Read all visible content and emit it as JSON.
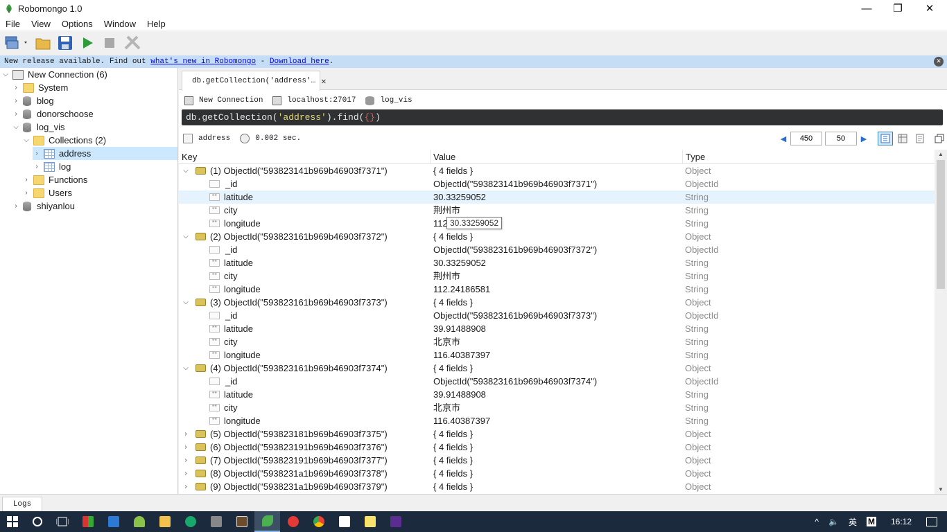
{
  "window": {
    "title": "Robomongo 1.0",
    "minimize": "—",
    "restore": "❐",
    "close": "✕"
  },
  "menu": [
    "File",
    "View",
    "Options",
    "Window",
    "Help"
  ],
  "notice": {
    "prefix": "New release available. Find out ",
    "link1": "what's new in Robomongo",
    "middle": " - ",
    "link2": "Download here",
    "suffix": "."
  },
  "tree": {
    "connection": "New Connection (6)",
    "system": "System",
    "db1": "blog",
    "db2": "donorschoose",
    "db3": "log_vis",
    "collections": "Collections (2)",
    "coll1": "address",
    "coll2": "log",
    "functions": "Functions",
    "users": "Users",
    "db4": "shiyanlou"
  },
  "tab": {
    "title": "db.getCollection('address'…"
  },
  "connbar": {
    "connection": "New Connection",
    "host": "localhost:27017",
    "db": "log_vis"
  },
  "query": {
    "prefix": "db.getCollection(",
    "arg": "'address'",
    "mid": ").find(",
    "braces": "{}",
    "suffix": ")"
  },
  "result": {
    "collection": "address",
    "time": "0.002 sec."
  },
  "pager": {
    "skip": "450",
    "limit": "50",
    "prev": "◀",
    "next": "▶"
  },
  "grid": {
    "columns": [
      "Key",
      "Value",
      "Type"
    ],
    "rows": [
      {
        "key": "(1) ObjectId(\"593823141b969b46903f7371\")",
        "value": "{ 4 fields }",
        "type": "Object"
      },
      {
        "key": "_id",
        "value": "ObjectId(\"593823141b969b46903f7371\")",
        "type": "ObjectId"
      },
      {
        "key": "latitude",
        "value": "30.33259052",
        "type": "String"
      },
      {
        "key": "city",
        "value": "荆州市",
        "type": "String"
      },
      {
        "key": "longitude",
        "value": "112",
        "type": "String"
      },
      {
        "key": "(2) ObjectId(\"593823161b969b46903f7372\")",
        "value": "{ 4 fields }",
        "type": "Object"
      },
      {
        "key": "_id",
        "value": "ObjectId(\"593823161b969b46903f7372\")",
        "type": "ObjectId"
      },
      {
        "key": "latitude",
        "value": "30.33259052",
        "type": "String"
      },
      {
        "key": "city",
        "value": "荆州市",
        "type": "String"
      },
      {
        "key": "longitude",
        "value": "112.24186581",
        "type": "String"
      },
      {
        "key": "(3) ObjectId(\"593823161b969b46903f7373\")",
        "value": "{ 4 fields }",
        "type": "Object"
      },
      {
        "key": "_id",
        "value": "ObjectId(\"593823161b969b46903f7373\")",
        "type": "ObjectId"
      },
      {
        "key": "latitude",
        "value": "39.91488908",
        "type": "String"
      },
      {
        "key": "city",
        "value": "北京市",
        "type": "String"
      },
      {
        "key": "longitude",
        "value": "116.40387397",
        "type": "String"
      },
      {
        "key": "(4) ObjectId(\"593823161b969b46903f7374\")",
        "value": "{ 4 fields }",
        "type": "Object"
      },
      {
        "key": "_id",
        "value": "ObjectId(\"593823161b969b46903f7374\")",
        "type": "ObjectId"
      },
      {
        "key": "latitude",
        "value": "39.91488908",
        "type": "String"
      },
      {
        "key": "city",
        "value": "北京市",
        "type": "String"
      },
      {
        "key": "longitude",
        "value": "116.40387397",
        "type": "String"
      },
      {
        "key": "(5) ObjectId(\"593823181b969b46903f7375\")",
        "value": "{ 4 fields }",
        "type": "Object"
      },
      {
        "key": "(6) ObjectId(\"593823191b969b46903f7376\")",
        "value": "{ 4 fields }",
        "type": "Object"
      },
      {
        "key": "(7) ObjectId(\"593823191b969b46903f7377\")",
        "value": "{ 4 fields }",
        "type": "Object"
      },
      {
        "key": "(8) ObjectId(\"5938231a1b969b46903f7378\")",
        "value": "{ 4 fields }",
        "type": "Object"
      },
      {
        "key": "(9) ObjectId(\"5938231a1b969b46903f7379\")",
        "value": "{ 4 fields }",
        "type": "Object"
      }
    ]
  },
  "tooltip": "30.33259052",
  "logs": "Logs",
  "taskbar": {
    "lang": "英",
    "ime": "M",
    "clock": "16:12",
    "volume": "🔈"
  }
}
